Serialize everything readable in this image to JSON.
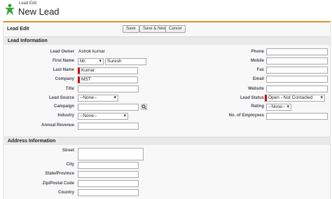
{
  "header": {
    "breadcrumb": "Lead Edit",
    "title": "New Lead"
  },
  "edit": {
    "title": "Lead Edit",
    "buttons": {
      "save": "Save",
      "save_new": "Save & New",
      "cancel": "Cancel"
    }
  },
  "lead_info": {
    "section_title": "Lead Information",
    "left": {
      "lead_owner": {
        "label": "Lead Owner",
        "value": "Ashok kumar"
      },
      "first_name": {
        "label": "First Name",
        "salutation": "Mr.",
        "value": "Suresh"
      },
      "last_name": {
        "label": "Last Name",
        "value": "Kumar"
      },
      "company": {
        "label": "Company",
        "value": "MST"
      },
      "title": {
        "label": "Title",
        "value": ""
      },
      "lead_source": {
        "label": "Lead Source",
        "value": "--None--"
      },
      "campaign": {
        "label": "Campaign",
        "value": ""
      },
      "industry": {
        "label": "Industry",
        "value": "--None--"
      },
      "annual_revenue": {
        "label": "Annual Revenue",
        "value": ""
      }
    },
    "right": {
      "phone": {
        "label": "Phone",
        "value": ""
      },
      "mobile": {
        "label": "Mobile",
        "value": ""
      },
      "fax": {
        "label": "Fax",
        "value": ""
      },
      "email": {
        "label": "Email",
        "value": ""
      },
      "website": {
        "label": "Website",
        "value": ""
      },
      "lead_status": {
        "label": "Lead Status",
        "value": "Open - Not Contacted"
      },
      "rating": {
        "label": "Rating",
        "value": "--None--"
      },
      "employees": {
        "label": "No. of Employees",
        "value": ""
      }
    }
  },
  "address": {
    "section_title": "Address Information",
    "street": {
      "label": "Street",
      "value": ""
    },
    "city": {
      "label": "City",
      "value": ""
    },
    "state": {
      "label": "State/Province",
      "value": ""
    },
    "zip": {
      "label": "Zip/Postal Code",
      "value": ""
    },
    "country": {
      "label": "Country",
      "value": ""
    }
  },
  "colors": {
    "accent": "#e39321",
    "required": "#cc0000"
  },
  "icons": {
    "logo": "salesforce-leads-icon",
    "lookup": "lookup-icon"
  }
}
